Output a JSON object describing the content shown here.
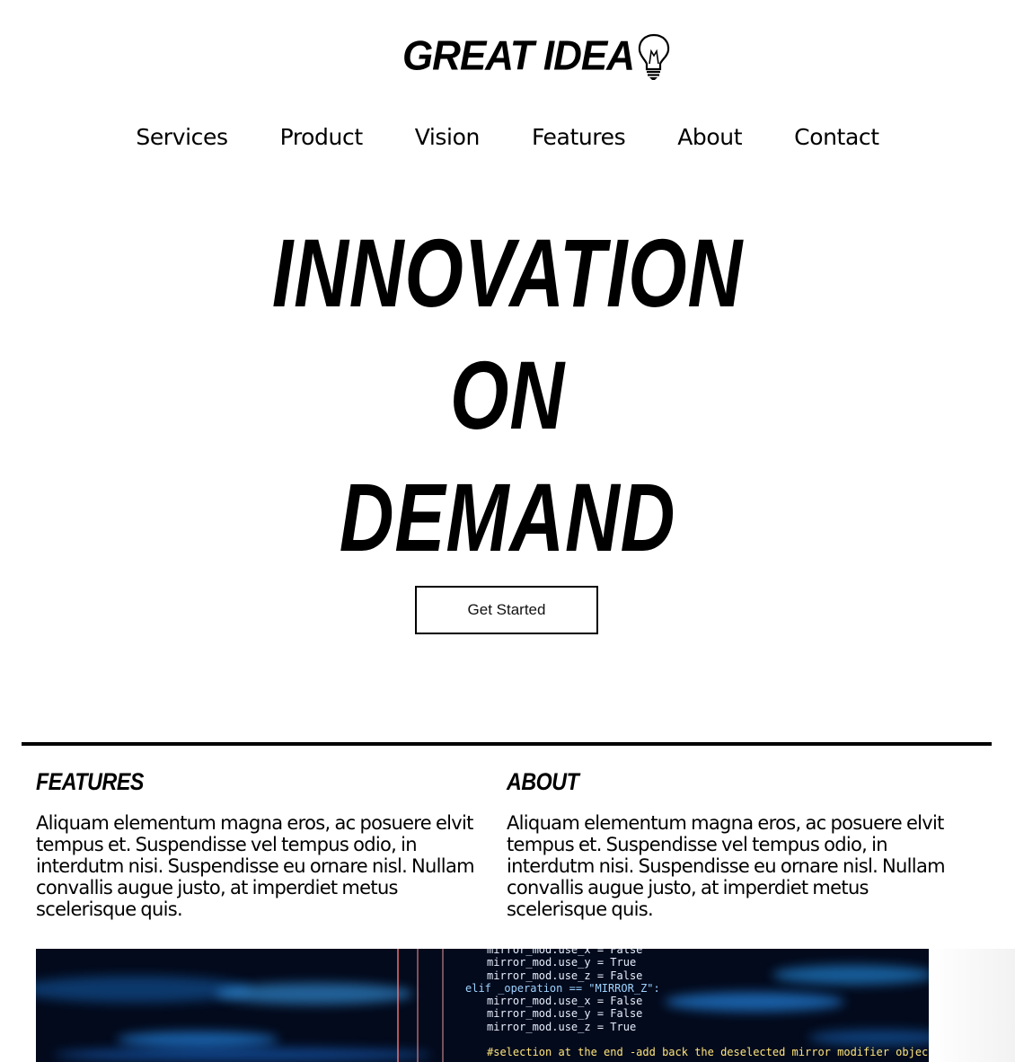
{
  "brand": {
    "name": "GREAT IDEA",
    "icon": "lightbulb-icon"
  },
  "nav": {
    "items": [
      {
        "label": "Services"
      },
      {
        "label": "Product"
      },
      {
        "label": "Vision"
      },
      {
        "label": "Features"
      },
      {
        "label": "About"
      },
      {
        "label": "Contact"
      }
    ]
  },
  "hero": {
    "line1": "INNOVATION",
    "line2": "ON",
    "line3": "DEMAND",
    "cta_label": "Get Started"
  },
  "sections": {
    "features": {
      "title": "FEATURES",
      "body": "Aliquam elementum magna eros, ac posuere elvit tempus et. Suspendisse vel tempus odio, in interdutm nisi. Suspendisse eu ornare nisl. Nullam convallis augue justo, at imperdiet metus scelerisque quis."
    },
    "about": {
      "title": "ABOUT",
      "body": "Aliquam elementum magna eros, ac posuere elvit tempus et. Suspendisse vel tempus odio, in interdutm nisi. Suspendisse eu ornare nisl. Nullam convallis augue justo, at imperdiet metus scelerisque quis."
    }
  },
  "code_image": {
    "lines": [
      "mirror_mod.use_x = False",
      "mirror_mod.use_y = True",
      "mirror_mod.use_z = False",
      "elif _operation == \"MIRROR_Z\":",
      "mirror_mod.use_x = False",
      "mirror_mod.use_y = False",
      "mirror_mod.use_z = True",
      "",
      "#selection at the end -add back the deselected mirror modifier object"
    ]
  },
  "colors": {
    "text": "#000000",
    "background": "#ffffff",
    "code_bg": "#030a1c",
    "code_glow": "#1e8fff"
  }
}
